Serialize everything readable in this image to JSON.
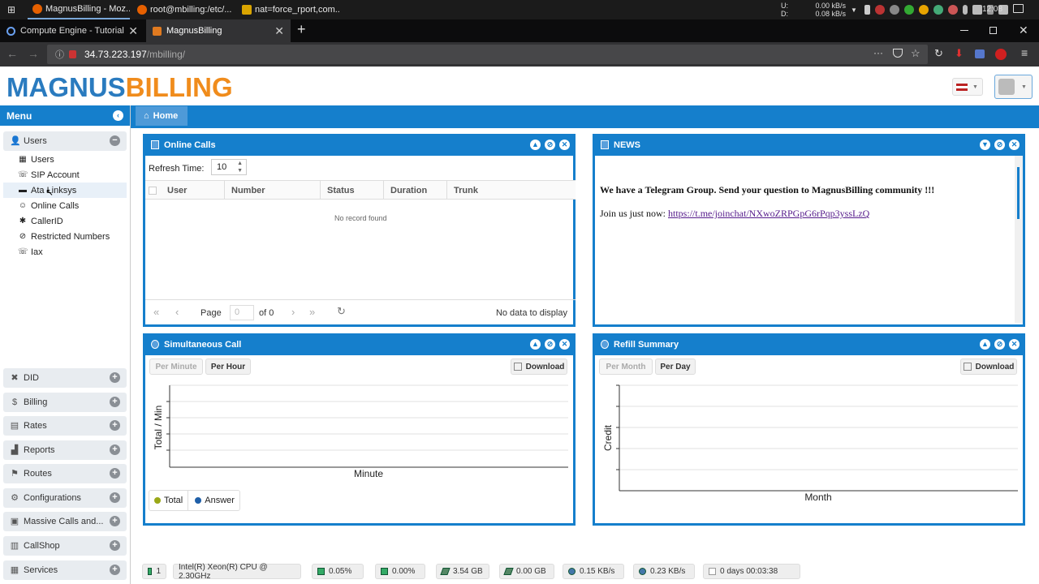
{
  "taskbar": {
    "tasks": [
      "MagnusBilling - Moz...",
      "root@mbilling:/etc/...",
      "nat=force_rport,com..."
    ],
    "net_u_label": "U:",
    "net_d_label": "D:",
    "net_u": "0.00 kB/s",
    "net_d": "0.08 kB/s",
    "clock": "12:08"
  },
  "browser": {
    "tabs": [
      "Compute Engine - Tutorial - Go",
      "MagnusBilling"
    ],
    "url_host": "34.73.223.197",
    "url_path": "/mbilling/",
    "new_tab": "+"
  },
  "app": {
    "logo_first": "MAGNUS",
    "logo_second": "BILLING"
  },
  "sidebar": {
    "title": "Menu",
    "users_group": "Users",
    "sub_items": [
      "Users",
      "SIP Account",
      "Ata Linksys",
      "Online Calls",
      "CallerID",
      "Restricted Numbers",
      "Iax"
    ],
    "groups": [
      "DID",
      "Billing",
      "Rates",
      "Reports",
      "Routes",
      "Configurations",
      "Massive Calls and...",
      "CallShop",
      "Services"
    ]
  },
  "tabs": {
    "home": "Home"
  },
  "online_calls": {
    "title": "Online Calls",
    "refresh_label": "Refresh Time:",
    "refresh_value": "10",
    "columns": [
      "User",
      "Number",
      "Status",
      "Duration",
      "Trunk"
    ],
    "empty": "No record found",
    "page_label": "Page",
    "page_value": "0",
    "of_label": "of 0",
    "no_data": "No data to display"
  },
  "news": {
    "title": "NEWS",
    "headline": "We have a Telegram Group. Send your question to MagnusBilling community !!!",
    "join_text": "Join us just now:",
    "link": "https://t.me/joinchat/NXwoZRPGpG6rPqp3yssLzQ"
  },
  "simultaneous": {
    "title": "Simultaneous Call",
    "btn_minute": "Per Minute",
    "btn_hour": "Per Hour",
    "download": "Download",
    "ylabel": "Total / Min",
    "xlabel": "Minute",
    "legend": [
      "Total",
      "Answer"
    ],
    "legend_colors": [
      "#9aa817",
      "#1f5fa8"
    ]
  },
  "refill": {
    "title": "Refill Summary",
    "btn_month": "Per Month",
    "btn_day": "Per Day",
    "download": "Download",
    "ylabel": "Credit",
    "xlabel": "Month"
  },
  "statusbar": {
    "items": [
      "1",
      "Intel(R) Xeon(R) CPU @ 2.30GHz",
      "0.05%",
      "0.00%",
      "3.54 GB",
      "0.00 GB",
      "0.15 KB/s",
      "0.23 KB/s",
      "0 days 00:03:38"
    ]
  },
  "colors": {
    "primary": "#157fcc",
    "logo_blue": "#2a7bbf",
    "logo_orange": "#f08c1c"
  }
}
